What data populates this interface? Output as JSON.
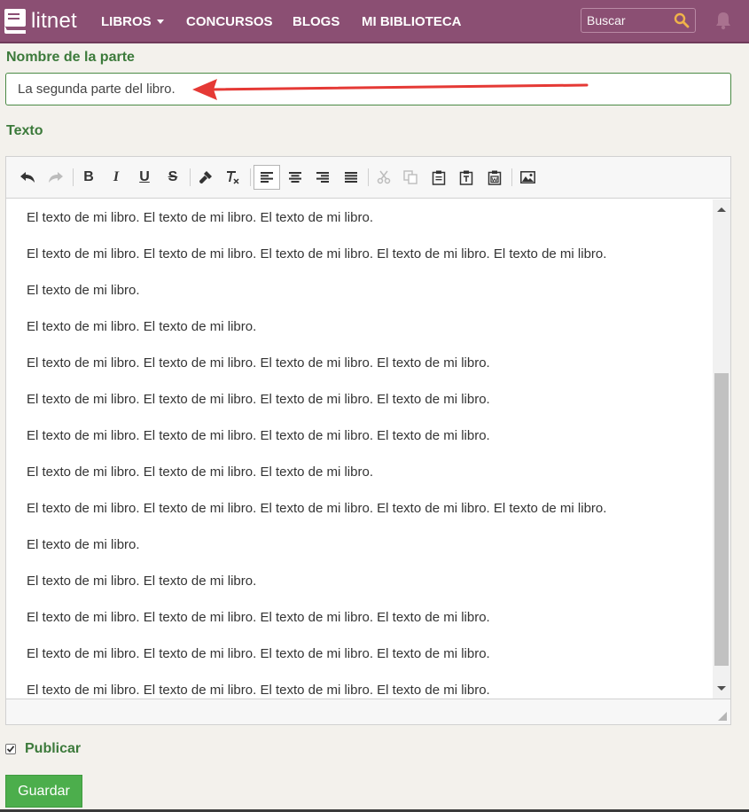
{
  "nav": {
    "logo_text": "litnet",
    "items": [
      "LIBROS",
      "CONCURSOS",
      "BLOGS",
      "MI BIBLIOTECA"
    ],
    "search_placeholder": "Buscar",
    "colors": {
      "bar": "#8b4f73",
      "search_icon": "#f0b34a"
    }
  },
  "form": {
    "part_name_label": "Nombre de la parte",
    "part_name_value": "La segunda parte del libro.",
    "text_label": "Texto",
    "publish_label": "Publicar",
    "publish_checked": true,
    "save_label": "Guardar"
  },
  "editor": {
    "toolbar": [
      "undo-icon",
      "redo-icon",
      "bold-icon",
      "italic-icon",
      "underline-icon",
      "strikethrough-icon",
      "format-painter-icon",
      "clear-formatting-icon",
      "align-left-icon",
      "align-center-icon",
      "align-right-icon",
      "align-justify-icon",
      "cut-icon",
      "copy-icon",
      "paste-icon",
      "paste-text-icon",
      "paste-word-icon",
      "image-icon"
    ],
    "active_tool": "align-left-icon",
    "paragraphs": [
      "El texto de mi libro. El texto de mi libro. El texto de mi libro.",
      "El texto de mi libro. El texto de mi libro. El texto de mi libro. El texto de mi libro. El texto de mi libro.",
      "El texto de mi libro.",
      "El texto de mi libro. El texto de mi libro.",
      "El texto de mi libro. El texto de mi libro. El texto de mi libro. El texto de mi libro.",
      "El texto de mi libro. El texto de mi libro. El texto de mi libro. El texto de mi libro.",
      "El texto de mi libro. El texto de mi libro. El texto de mi libro. El texto de mi libro.",
      "El texto de mi libro. El texto de mi libro. El texto de mi libro.",
      "El texto de mi libro. El texto de mi libro. El texto de mi libro. El texto de mi libro. El texto de mi libro.",
      "El texto de mi libro.",
      "El texto de mi libro. El texto de mi libro.",
      "El texto de mi libro. El texto de mi libro. El texto de mi libro. El texto de mi libro.",
      "El texto de mi libro. El texto de mi libro. El texto de mi libro. El texto de mi libro.",
      "El texto de mi libro. El texto de mi libro. El texto de mi libro. El texto de mi libro."
    ]
  },
  "annotation": {
    "arrow_color": "#e53935"
  }
}
